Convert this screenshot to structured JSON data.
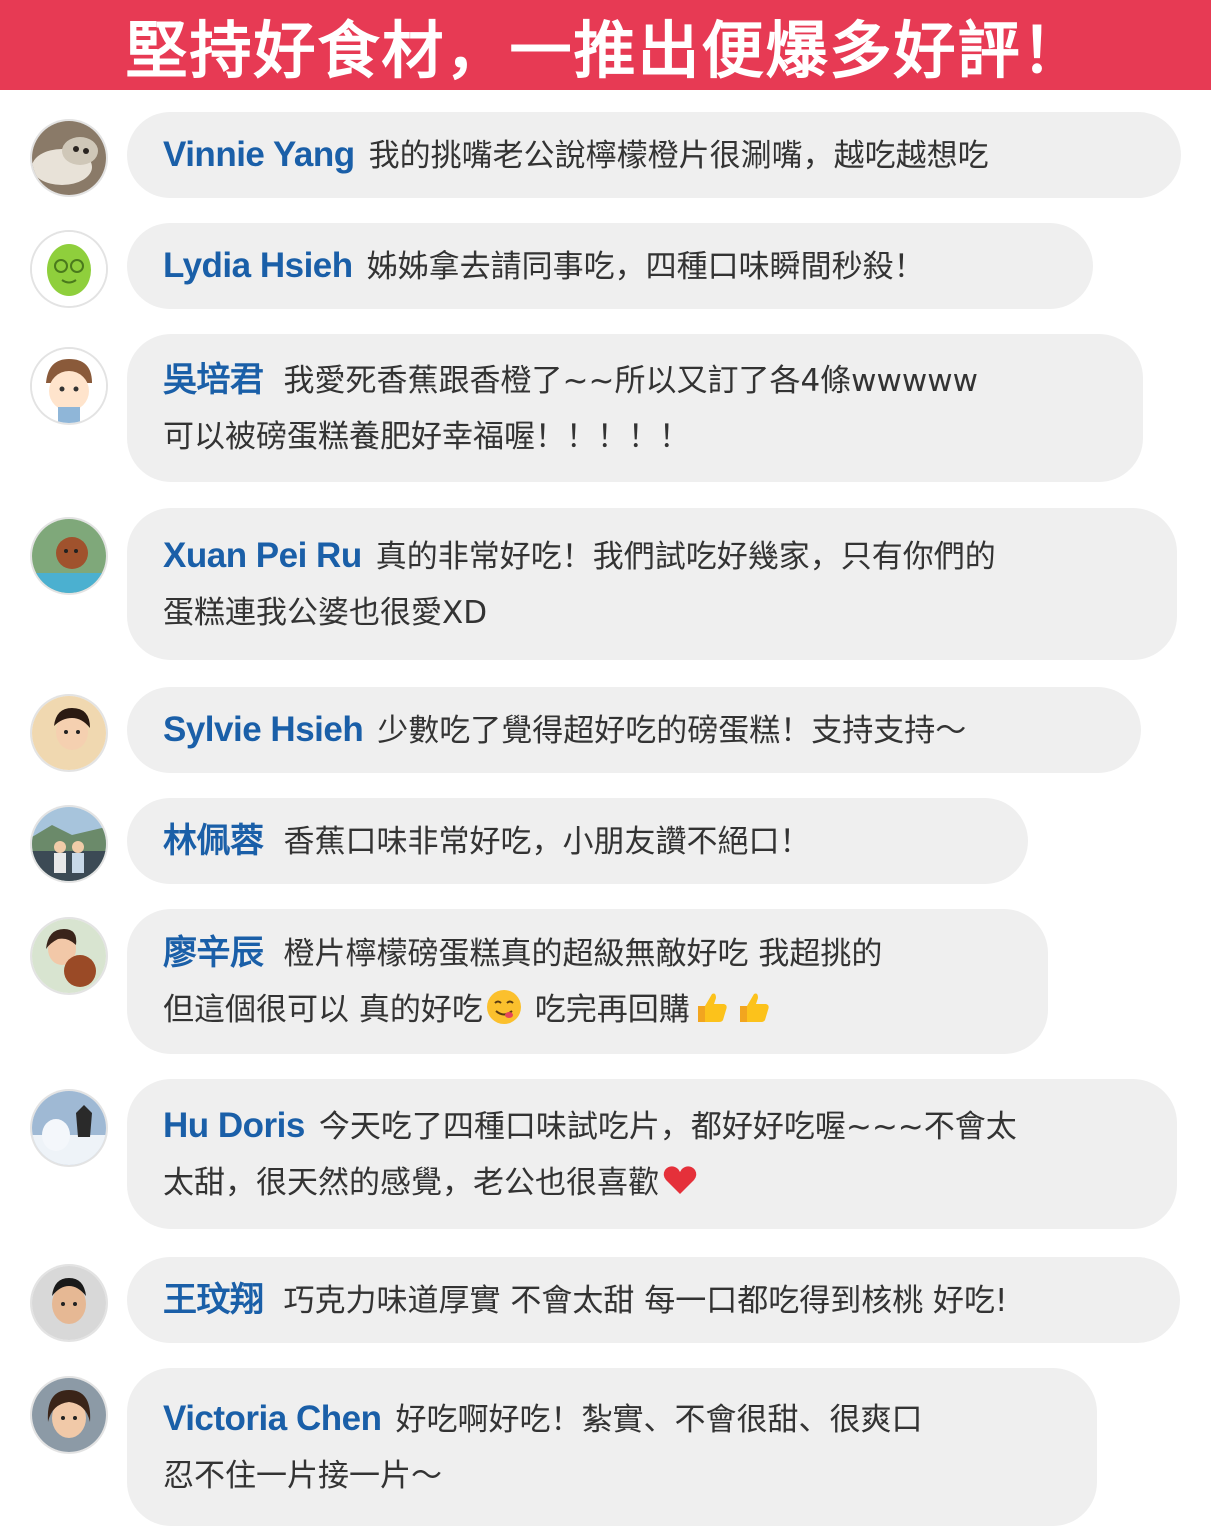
{
  "banner": {
    "title": "堅持好食材，一推出便爆多好評！"
  },
  "colors": {
    "banner": "#e73a54",
    "name": "#1a5fa8",
    "bubble": "#efefef",
    "text": "#333333"
  },
  "comments": [
    {
      "name": "Vinnie Yang",
      "line1": "我的挑嘴老公說檸檬橙片很涮嘴，越吃越想吃",
      "line2": "",
      "avatar_icon": "cat-photo-avatar"
    },
    {
      "name": "Lydia Hsieh",
      "line1": "姊姊拿去請同事吃，四種口味瞬間秒殺！",
      "line2": "",
      "avatar_icon": "green-cartoon-avatar"
    },
    {
      "name": "吳培君",
      "line1": "我愛死香蕉跟香橙了~~所以又訂了各4條wwwww",
      "line2": "可以被磅蛋糕養肥好幸福喔！！！！！",
      "avatar_icon": "cartoon-boy-avatar"
    },
    {
      "name": "Xuan Pei Ru",
      "line1": "真的非常好吃！我們試吃好幾家，只有你們的",
      "line2": "蛋糕連我公婆也很愛XD",
      "avatar_icon": "dog-photo-avatar"
    },
    {
      "name": "Sylvie Hsieh",
      "line1": "少數吃了覺得超好吃的磅蛋糕！支持支持～",
      "line2": "",
      "avatar_icon": "woman-photo-avatar"
    },
    {
      "name": "林佩蓉",
      "line1": "香蕉口味非常好吃，小朋友讚不絕口！",
      "line2": "",
      "avatar_icon": "family-photo-avatar"
    },
    {
      "name": "廖辛辰",
      "line1": "橙片檸檬磅蛋糕真的超級無敵好吃  我超挑的",
      "line2a": "但這個很可以 真的好吃",
      "line2b": " 吃完再回購",
      "avatar_icon": "woman-dog-photo-avatar"
    },
    {
      "name": "Hu Doris",
      "line1": "今天吃了四種口味試吃片，都好好吃喔~~~不會太",
      "line2": "太甜，很天然的感覺，老公也很喜歡",
      "avatar_icon": "snow-photo-avatar"
    },
    {
      "name": "王玟翔",
      "line1": "巧克力味道厚實 不會太甜 每一口都吃得到核桃 好吃!",
      "line2": "",
      "avatar_icon": "man-photo-avatar"
    },
    {
      "name": "Victoria Chen",
      "line1": "好吃啊好吃！紮實、不會很甜、很爽口",
      "line2": "忍不住一片接一片～",
      "avatar_icon": "woman-portrait-avatar"
    }
  ]
}
